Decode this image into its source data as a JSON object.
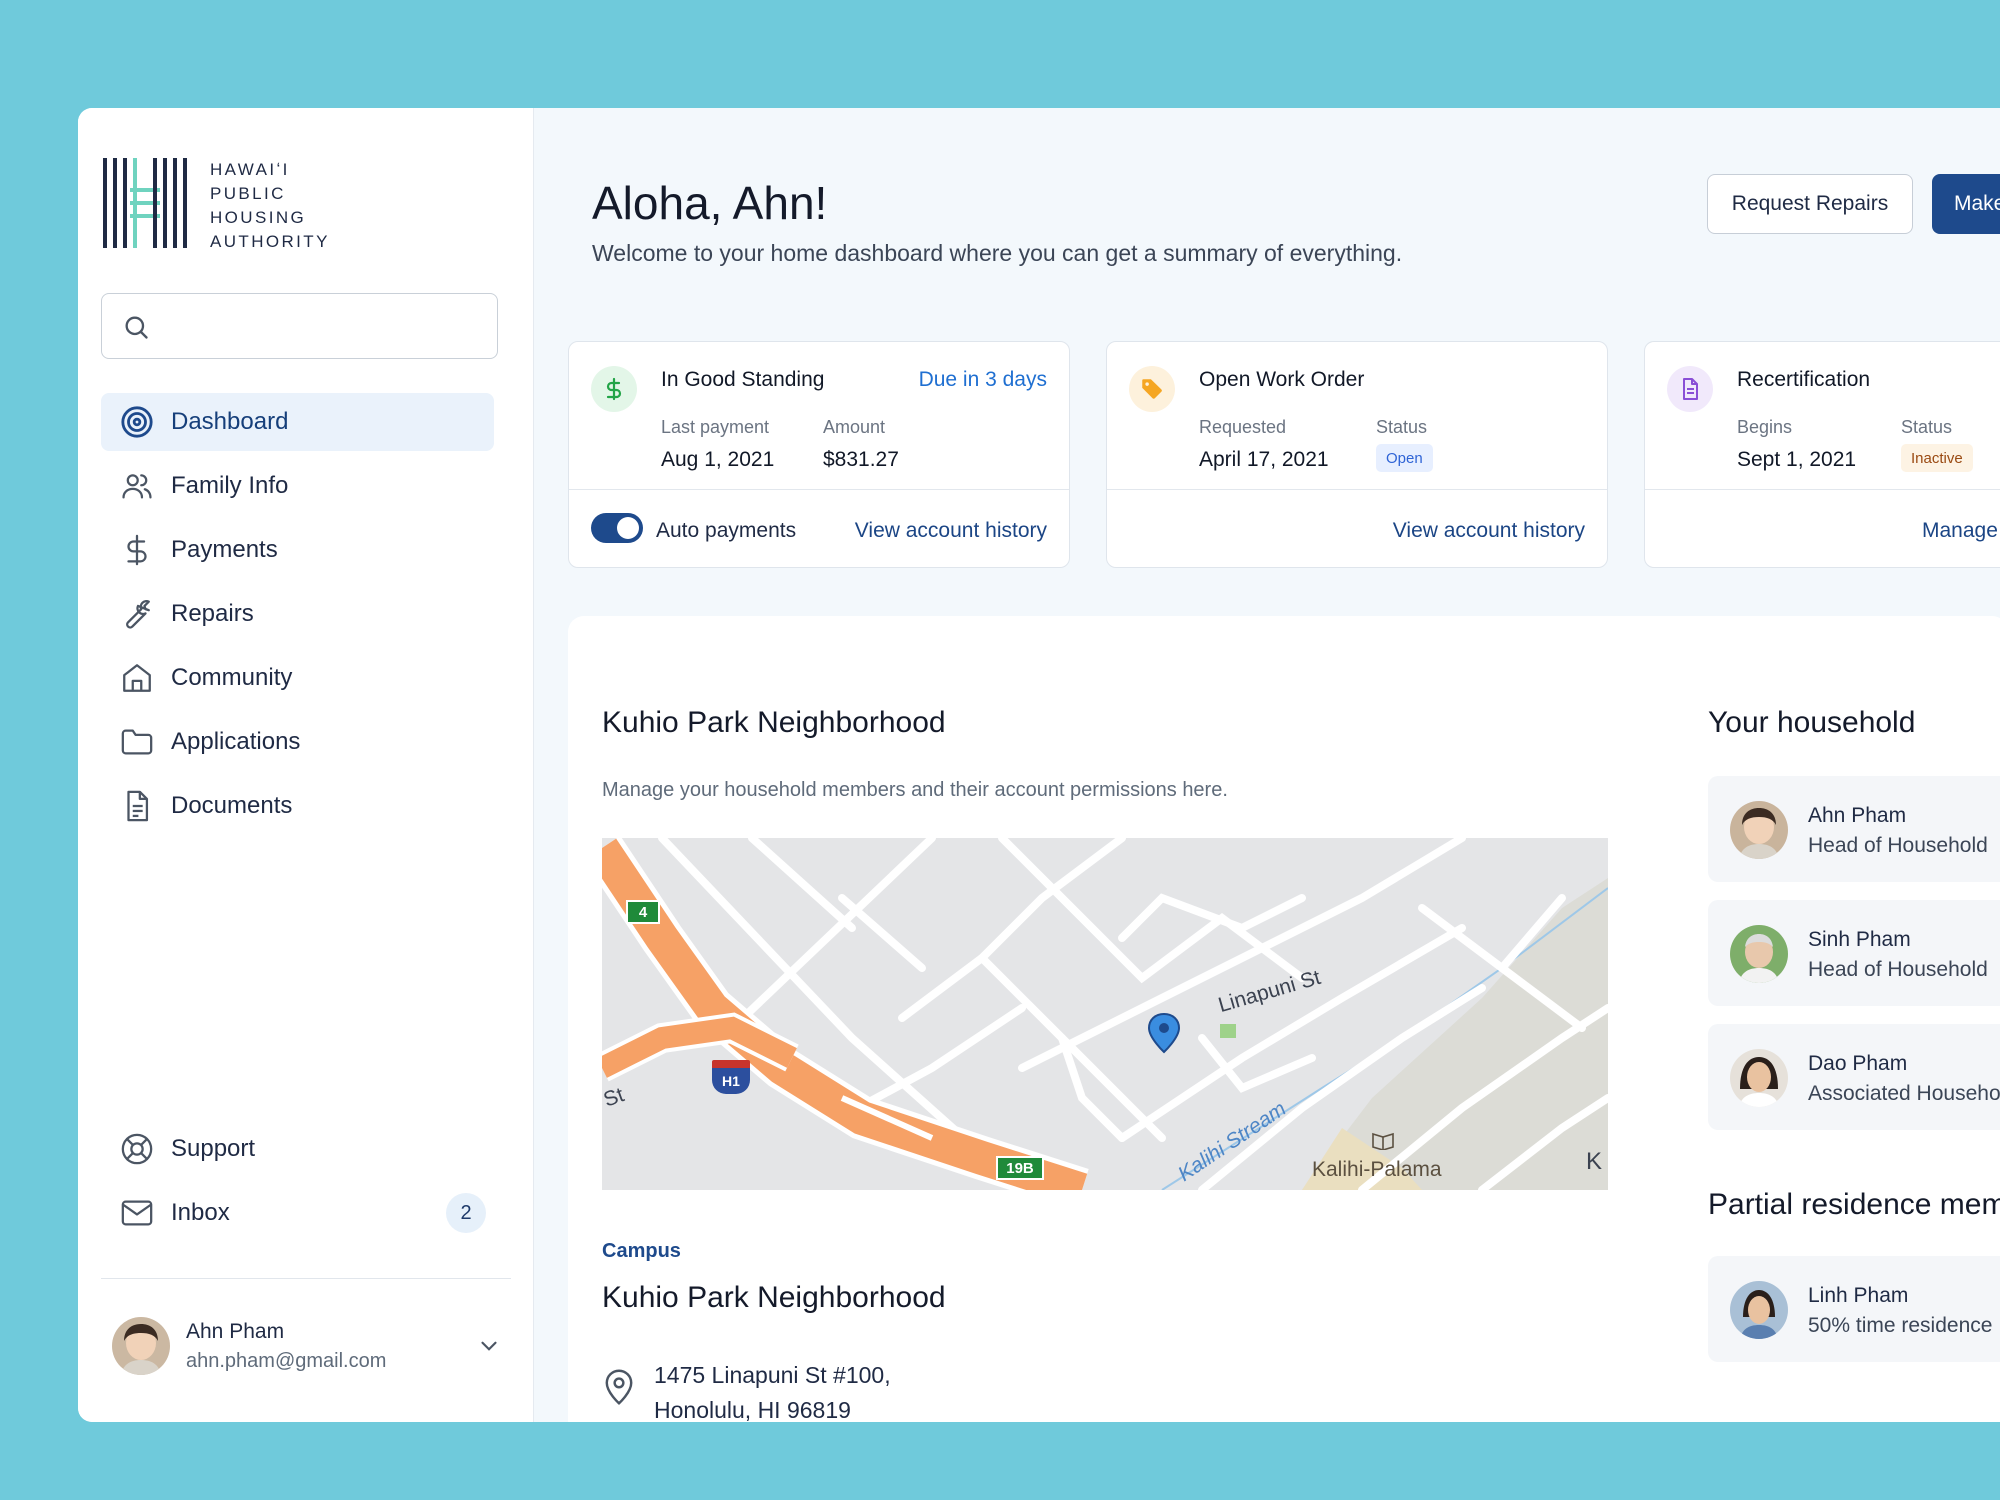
{
  "org": {
    "line1": "HAWAIʻI",
    "line2": "PUBLIC",
    "line3": "HOUSING",
    "line4": "AUTHORITY"
  },
  "search": {
    "placeholder": ""
  },
  "nav": {
    "items": [
      {
        "label": "Dashboard",
        "icon": "target-icon"
      },
      {
        "label": "Family Info",
        "icon": "users-icon"
      },
      {
        "label": "Payments",
        "icon": "dollar-icon"
      },
      {
        "label": "Repairs",
        "icon": "wrench-icon"
      },
      {
        "label": "Community",
        "icon": "home-icon"
      },
      {
        "label": "Applications",
        "icon": "folder-icon"
      },
      {
        "label": "Documents",
        "icon": "document-icon"
      }
    ],
    "bottom": [
      {
        "label": "Support",
        "icon": "lifebuoy-icon"
      },
      {
        "label": "Inbox",
        "icon": "mail-icon",
        "badge": "2"
      }
    ]
  },
  "user": {
    "name": "Ahn Pham",
    "email": "ahn.pham@gmail.com"
  },
  "header": {
    "greeting": "Aloha, Ahn!",
    "subtitle": "Welcome to your home dashboard where you can get a summary of everything.",
    "request_repairs": "Request Repairs",
    "make_payment": "Make"
  },
  "cards": [
    {
      "title": "In Good Standing",
      "due": "Due in 3 days",
      "label1": "Last payment",
      "value1": "Aug 1, 2021",
      "label2": "Amount",
      "value2": "$831.27",
      "auto_payments": "Auto payments",
      "link": "View account history"
    },
    {
      "title": "Open Work Order",
      "label1": "Requested",
      "value1": "April 17, 2021",
      "label2": "Status",
      "status": "Open",
      "link": "View account history"
    },
    {
      "title": "Recertification",
      "label1": "Begins",
      "value1": "Sept 1, 2021",
      "label2": "Status",
      "status": "Inactive",
      "link": "Manage"
    }
  ],
  "neighborhood": {
    "title": "Kuhio Park Neighborhood",
    "subtitle": "Manage your household members and their account permissions here.",
    "campus_label": "Campus",
    "campus_name": "Kuhio Park Neighborhood",
    "address_line1": "1475 Linapuni St #100,",
    "address_line2": "Honolulu, HI 96819"
  },
  "map": {
    "street_linapuni": "Linapuni St",
    "street_st": "St",
    "stream": "Kalihi Stream",
    "area": "Kalihi-Palama",
    "route_4": "4",
    "route_h1": "H1",
    "route_19b": "19B",
    "edge_k": "K"
  },
  "household": {
    "title": "Your household",
    "members": [
      {
        "name": "Ahn Pham",
        "role": "Head of Household"
      },
      {
        "name": "Sinh Pham",
        "role": "Head of Household"
      },
      {
        "name": "Dao Pham",
        "role": "Associated Household Me"
      }
    ],
    "partial_title": "Partial residence member",
    "partial": [
      {
        "name": "Linh Pham",
        "role": "50% time residence"
      }
    ]
  },
  "colors": {
    "background": "#6fcadb",
    "primary": "#1e4a8c",
    "link": "#1f6fd1",
    "highway": "#f6a166"
  }
}
